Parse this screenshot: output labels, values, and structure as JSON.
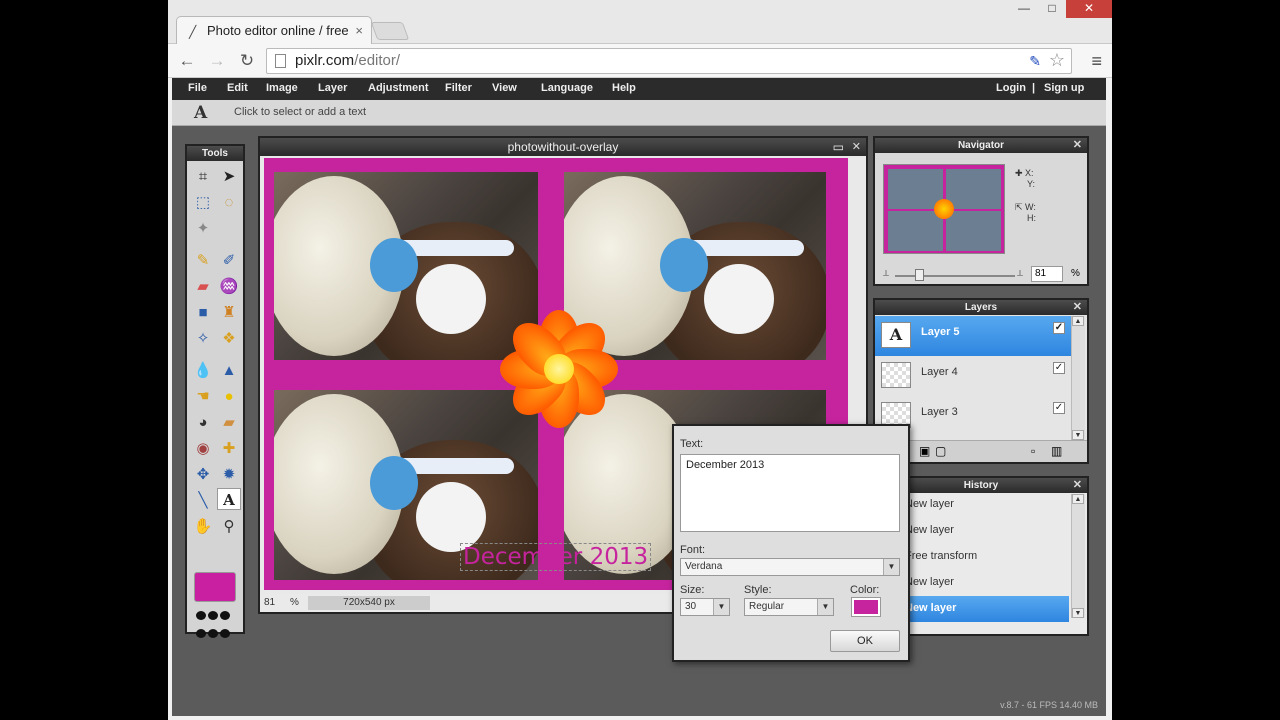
{
  "browser": {
    "tab_title": "Photo editor online / free",
    "tab_close": "×",
    "url_host": "pixlr.com",
    "url_path": "/editor/",
    "window": {
      "minimize": "—",
      "maximize": "□",
      "close": "✕"
    }
  },
  "menubar": {
    "items": [
      "File",
      "Edit",
      "Image",
      "Layer",
      "Adjustment",
      "Filter",
      "View",
      "Language",
      "Help"
    ],
    "login": "Login",
    "separator": "|",
    "signup": "Sign up"
  },
  "options_bar": {
    "tool_glyph": "A",
    "hint": "Click to select or add a text"
  },
  "tools_panel": {
    "title": "Tools",
    "foreground_color": "#c6249e"
  },
  "image_window": {
    "title": "photowithout-overlay",
    "canvas_text": "December 2013",
    "zoom": "81",
    "zoom_unit": "%",
    "dimensions": "720x540 px",
    "border_color": "#c6249e"
  },
  "navigator": {
    "title": "Navigator",
    "x_label": "X:",
    "y_label": "Y:",
    "w_label": "W:",
    "h_label": "H:",
    "zoom": "81",
    "zoom_unit": "%"
  },
  "layers": {
    "title": "Layers",
    "items": [
      {
        "name": "Layer 5",
        "thumb": "A",
        "visible": "✓",
        "selected": true
      },
      {
        "name": "Layer 4",
        "thumb": "",
        "visible": "✓",
        "selected": false
      },
      {
        "name": "Layer 3",
        "thumb": "",
        "visible": "✓",
        "selected": false
      }
    ]
  },
  "history": {
    "title": "History",
    "items": [
      "New layer",
      "New layer",
      "Free transform",
      "New layer",
      "New layer"
    ]
  },
  "text_dialog": {
    "text_label": "Text:",
    "text_value": "December 2013",
    "font_label": "Font:",
    "font_value": "Verdana",
    "size_label": "Size:",
    "size_value": "30",
    "style_label": "Style:",
    "style_value": "Regular",
    "color_label": "Color:",
    "color_value": "#c6249e",
    "ok": "OK"
  },
  "footer": {
    "version": "v.8.7 - 61 FPS 14.40 MB"
  }
}
